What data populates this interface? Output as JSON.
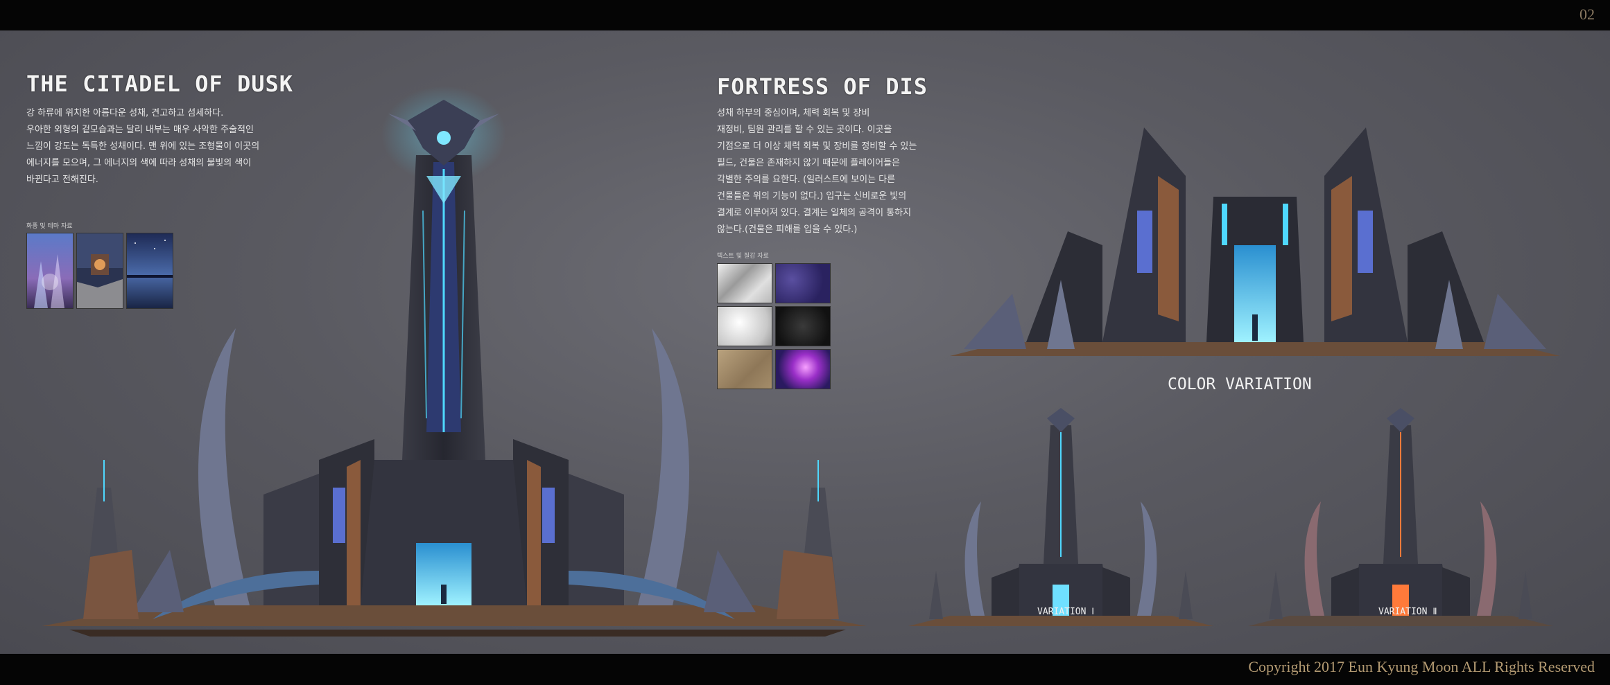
{
  "page_number": "02",
  "copyright": "Copyright 2017 Eun Kyung Moon ALL Rights Reserved",
  "left": {
    "title": "THE CITADEL OF DUSK",
    "description": [
      "강 하류에 위치한 아름다운 성채, 견고하고 섬세하다.",
      "우아한 외형의 겉모습과는 달리 내부는 매우 사악한 주술적인",
      "느낌이 강도는 독특한 성채이다. 맨 위에 있는 조형물이 이곳의",
      "에너지를 모으며, 그 에너지의 색에 따라 성채의 불빛의 색이",
      "바뀐다고 전해진다."
    ],
    "reference_label": "화풍 및 테마 자료"
  },
  "right": {
    "title": "FORTRESS OF DIS",
    "description": [
      "성채 하부의 중심이며, 체력 회복 및 장비",
      "재정비, 팀원 관리를 할 수 있는 곳이다. 이곳을",
      "기점으로 더 이상 체력 회복 및 장비를 정비할 수 있는",
      "필드, 건물은 존재하지 않기 때문에 플레이어들은",
      "각별한 주의를 요한다. (일러스트에 보이는 다른",
      "건물들은 위의 기능이 없다.) 입구는 신비로운 빛의",
      "결계로 이루어져 있다. 결계는 일체의 공격이 통하지",
      "않는다.(건물은 피해를 입을 수 있다.)"
    ],
    "texture_label": "텍스트 및 질감 자료"
  },
  "color_variation": {
    "title": "COLOR VARIATION",
    "variations": [
      "VARIATION Ⅰ",
      "VARIATION Ⅱ"
    ]
  },
  "colors": {
    "glow_cyan": "#4fd8ff",
    "glow_orange": "#ff7a3a",
    "stone_dark": "#2c2d35",
    "copper": "#8a5a3c",
    "accent_text": "#b39a72"
  }
}
